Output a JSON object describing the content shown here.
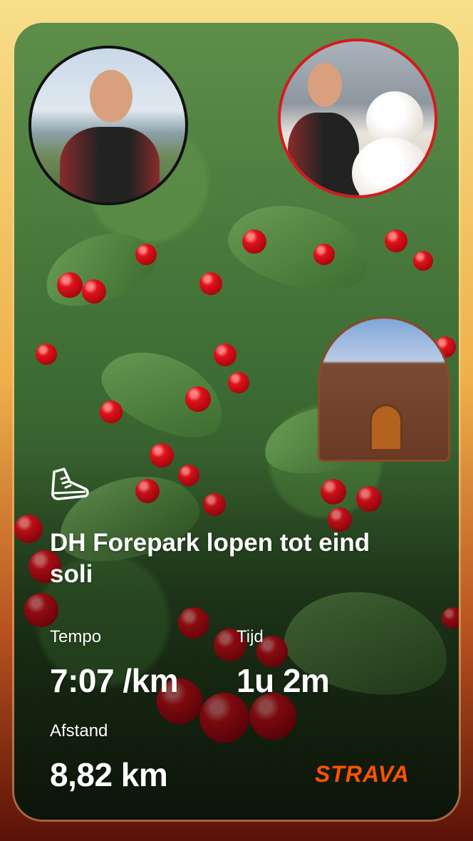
{
  "activity": {
    "title": "DH Forepark lopen tot eind soli",
    "icon": "running-shoe-icon"
  },
  "stats": {
    "pace_label": "Tempo",
    "pace_value": "7:07 /km",
    "time_label": "Tijd",
    "time_value": "1u 2m",
    "distance_label": "Afstand",
    "distance_value": "8,82 km"
  },
  "brand": {
    "name": "STRAVA",
    "color": "#fc5200"
  }
}
